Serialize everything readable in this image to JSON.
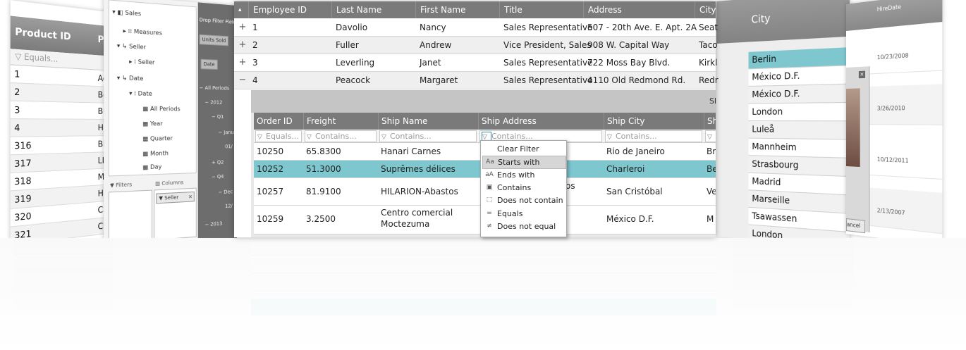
{
  "product_panel": {
    "header": "Product ID",
    "header2": "Pr",
    "filter_placeholder": "Equals...",
    "rows": [
      {
        "id": "1",
        "c2": "Ac"
      },
      {
        "id": "2",
        "c2": "Be"
      },
      {
        "id": "3",
        "c2": "BE"
      },
      {
        "id": "4",
        "c2": "He"
      },
      {
        "id": "316",
        "c2": "Bl"
      },
      {
        "id": "317",
        "c2": "LL"
      },
      {
        "id": "318",
        "c2": "MI"
      },
      {
        "id": "319",
        "c2": "HL"
      },
      {
        "id": "320",
        "c2": "Ch"
      },
      {
        "id": "321",
        "c2": "Ch"
      }
    ]
  },
  "pivot": {
    "tree": {
      "root": "Sales",
      "measures": "Measures",
      "seller_group": "Seller",
      "seller": "Seller",
      "date_group": "Date",
      "date": "Date",
      "all_periods": "All Periods",
      "year": "Year",
      "quarter": "Quarter",
      "month": "Month",
      "day": "Day"
    },
    "drop_filter_label": "Drop Filter Fields",
    "units_sold_chip": "Units Sold",
    "date_chip": "Date",
    "all_periods_label": "All Periods",
    "year_2012": "2012",
    "q1": "Q1",
    "jan": "Janu",
    "q2": "Q2",
    "q4": "Q4",
    "dec": "Dec",
    "val_01": "01/",
    "val_12": "12/",
    "year_2013": "2013",
    "filters_label": "Filters",
    "columns_label": "Columns",
    "seller_chip": "Seller"
  },
  "main_grid": {
    "columns": [
      "Employee ID",
      "Last Name",
      "First Name",
      "Title",
      "Address",
      "City"
    ],
    "rows": [
      {
        "expander": "+",
        "id": "1",
        "last": "Davolio",
        "first": "Nancy",
        "title": "Sales Representative",
        "address": "507 - 20th Ave. E. Apt. 2A",
        "city": "Seat"
      },
      {
        "expander": "+",
        "id": "2",
        "last": "Fuller",
        "first": "Andrew",
        "title": "Vice President, Sales",
        "address": "908 W. Capital Way",
        "city": "Taco"
      },
      {
        "expander": "+",
        "id": "3",
        "last": "Leverling",
        "first": "Janet",
        "title": "Sales Representative",
        "address": "722 Moss Bay Blvd.",
        "city": "Kirkl"
      },
      {
        "expander": "−",
        "id": "4",
        "last": "Peacock",
        "first": "Margaret",
        "title": "Sales Representative",
        "address": "4110 Old Redmond Rd.",
        "city": "Redr"
      }
    ],
    "header_expander": "▴"
  },
  "detail_grid": {
    "band_text": "Sh",
    "columns": [
      "Order ID",
      "Freight",
      "Ship Name",
      "Ship Address",
      "Ship City",
      "Sh"
    ],
    "filters": [
      "Equals...",
      "Contains...",
      "Contains...",
      "Contains...",
      "Contains..."
    ],
    "rows": [
      {
        "order": "10250",
        "freight": "65.8300",
        "name": "Hanari Carnes",
        "name2": "",
        "address": "",
        "city": "Rio de Janeiro",
        "c6": "Br"
      },
      {
        "order": "10252",
        "freight": "51.3000",
        "name": "Suprêmes délices",
        "name2": "",
        "address": "",
        "city": "Charleroi",
        "c6": "Be"
      },
      {
        "order": "10257",
        "freight": "81.9100",
        "name": "HILARION-Abastos",
        "name2": "",
        "address": "os",
        "city": "San Cristóbal",
        "c6": "Ve"
      },
      {
        "order": "10259",
        "freight": "3.2500",
        "name": "Centro comercial",
        "name2": "Moctezuma",
        "address": "",
        "city": "México D.F.",
        "c6": "M"
      }
    ]
  },
  "filter_menu": {
    "items": [
      {
        "icon": "",
        "label": "Clear Filter"
      },
      {
        "icon": "Aa",
        "label": "Starts with"
      },
      {
        "icon": "aA",
        "label": "Ends with"
      },
      {
        "icon": "▣",
        "label": "Contains"
      },
      {
        "icon": "⬚",
        "label": "Does not contain"
      },
      {
        "icon": "=",
        "label": "Equals"
      },
      {
        "icon": "≠",
        "label": "Does not equal"
      }
    ]
  },
  "city_panel": {
    "header": "City",
    "items": [
      "Berlin",
      "México D.F.",
      "México D.F.",
      "London",
      "Luleå",
      "Mannheim",
      "Strasbourg",
      "Madrid",
      "Marseille",
      "Tsawassen",
      "London"
    ]
  },
  "hire_panel": {
    "header": "HireDate",
    "dates": [
      "10/23/2008",
      "3/26/2010",
      "10/12/2011",
      "2/13/2007"
    ],
    "close": "×",
    "cancel": "ancel"
  },
  "colors": {
    "header_gray": "#7a7a7a",
    "selection_teal": "#7fc7cf"
  }
}
